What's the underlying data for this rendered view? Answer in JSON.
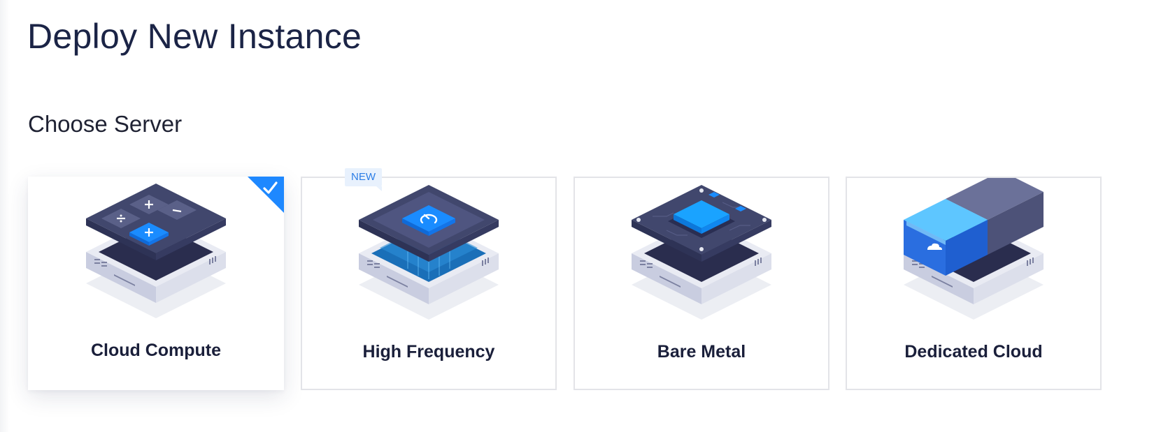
{
  "page": {
    "title": "Deploy New Instance"
  },
  "section": {
    "title": "Choose Server"
  },
  "colors": {
    "accent": "#1E88FF",
    "card_border": "#E3E4E8",
    "title_text": "#1B2446"
  },
  "server_types": [
    {
      "label": "Cloud Compute",
      "selected": true,
      "icon": "calculator-chip-icon"
    },
    {
      "label": "High Frequency",
      "selected": false,
      "badge": "NEW",
      "icon": "speedometer-chip-icon"
    },
    {
      "label": "Bare Metal",
      "selected": false,
      "icon": "processor-chip-icon"
    },
    {
      "label": "Dedicated Cloud",
      "selected": false,
      "icon": "cloud-blade-icon"
    }
  ]
}
